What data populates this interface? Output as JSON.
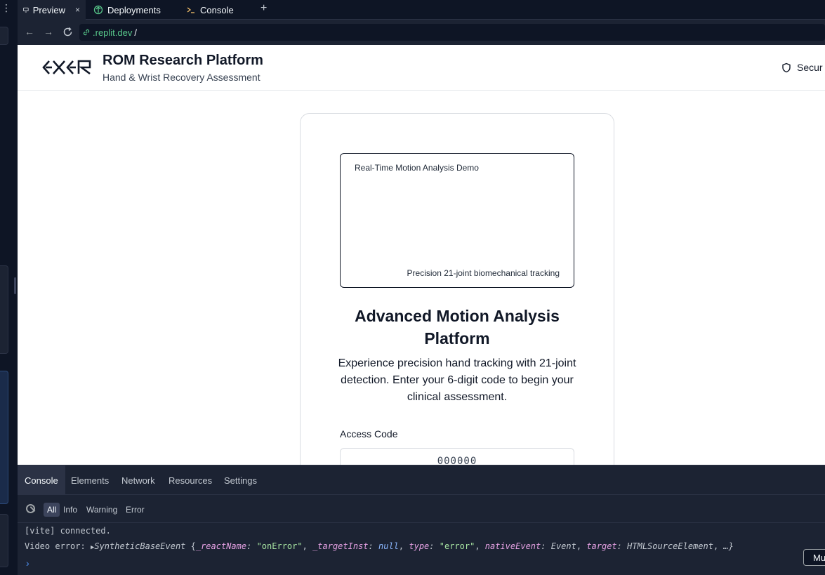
{
  "tabs": [
    {
      "label": "Preview",
      "close": "×"
    },
    {
      "label": "Deployments"
    },
    {
      "label": "Console"
    }
  ],
  "tab_add": "+",
  "url": {
    "host": ".replit.dev",
    "path": "/"
  },
  "header": {
    "title": "ROM Research Platform",
    "subtitle": "Hand & Wrist Recovery Assessment",
    "secure_label": "Secur"
  },
  "card": {
    "demo_title": "Real-Time Motion Analysis Demo",
    "demo_caption": "Precision 21-joint biomechanical tracking",
    "title": "Advanced Motion Analysis Platform",
    "description": "Experience precision hand tracking with 21-joint detection. Enter your 6-digit code to begin your clinical assessment.",
    "access_label": "Access Code",
    "access_placeholder": "000000"
  },
  "devtools": {
    "tabs": [
      "Console",
      "Elements",
      "Network",
      "Resources",
      "Settings"
    ],
    "filters": [
      "All",
      "Info",
      "Warning",
      "Error"
    ],
    "logs": {
      "line1": "[vite] connected.",
      "prefix": "Video error:",
      "event": "SyntheticBaseEvent",
      "k1": "_reactName",
      "v1": "\"onError\"",
      "k2": "_targetInst",
      "v2": "null",
      "k3": "type",
      "v3": "\"error\"",
      "k4": "nativeEvent",
      "v4": "Event",
      "k5": "target",
      "v5": "HTMLSourceElement",
      "tail": "…}"
    }
  },
  "corner_button": "Mu",
  "colors": {
    "accent": "#58c88b",
    "prompt": "#4f8ff0"
  }
}
